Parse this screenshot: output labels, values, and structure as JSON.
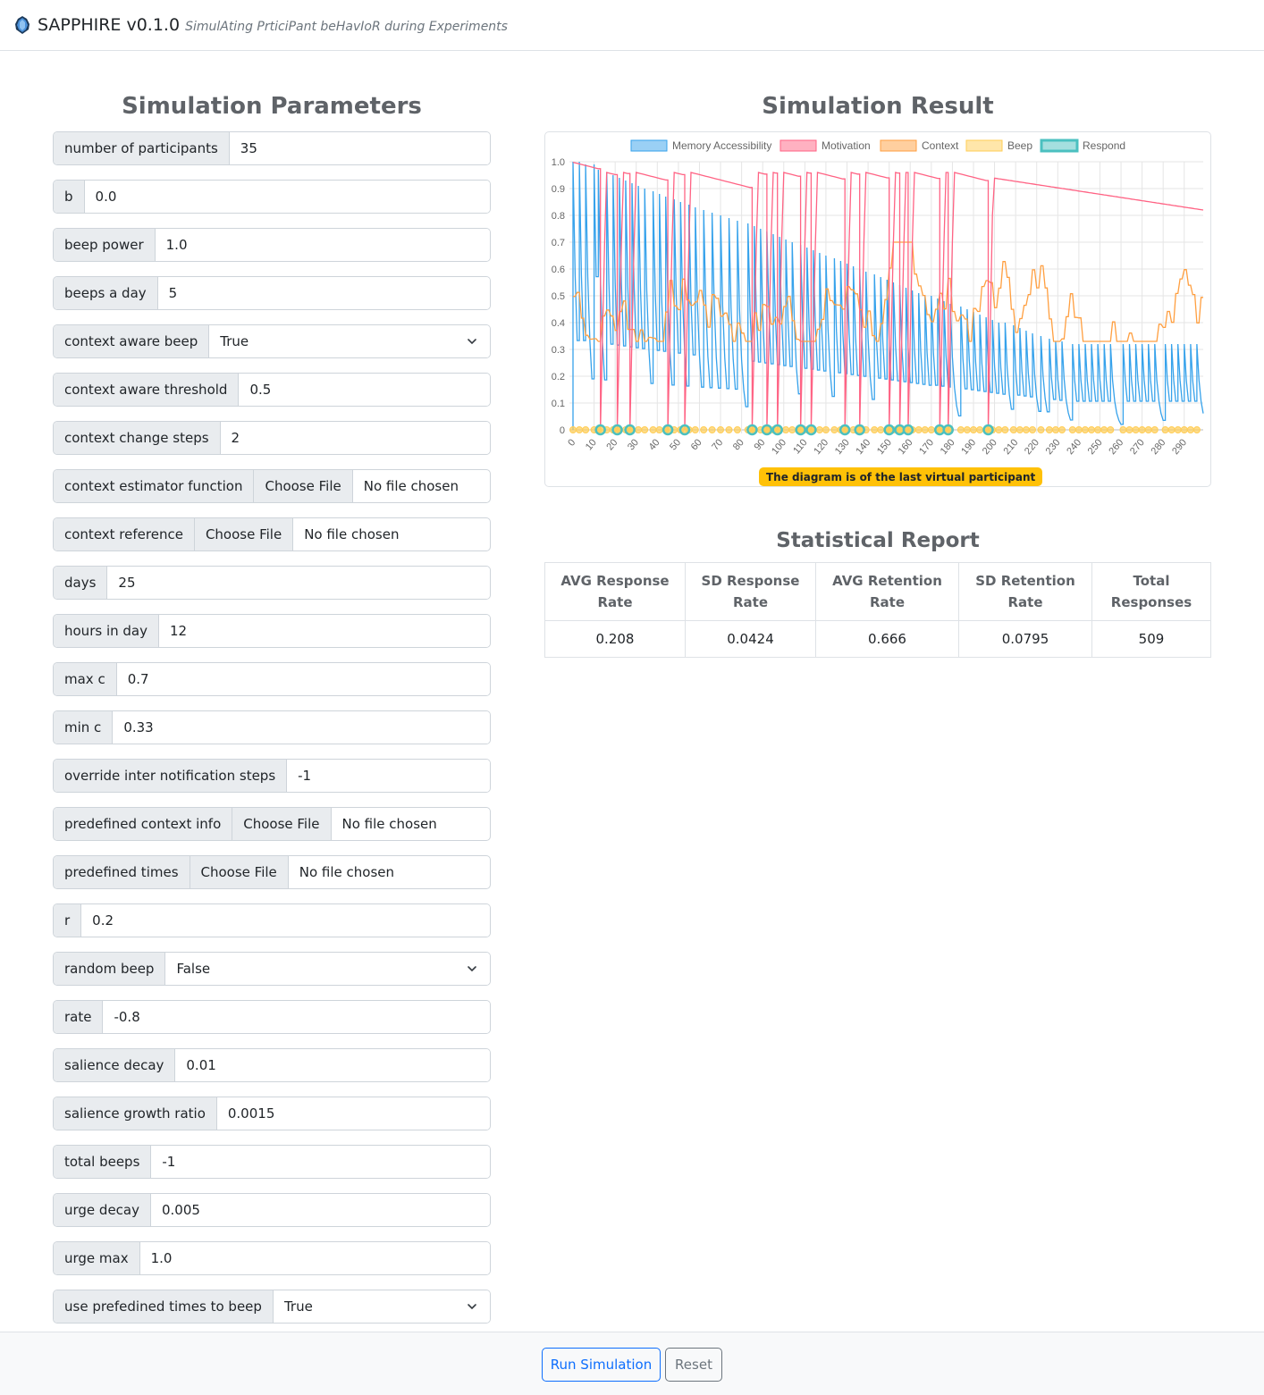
{
  "header": {
    "app_name": "SAPPHIRE v0.1.0",
    "tagline": "SimulAting PrticiPant beHavIoR during Experiments",
    "logo_icon": "sapphire-gem-icon"
  },
  "parameters": {
    "title": "Simulation Parameters",
    "fields": [
      {
        "label": "number of participants",
        "type": "input",
        "value": "35"
      },
      {
        "label": "b",
        "type": "input",
        "value": "0.0"
      },
      {
        "label": "beep power",
        "type": "input",
        "value": "1.0"
      },
      {
        "label": "beeps a day",
        "type": "input",
        "value": "5"
      },
      {
        "label": "context aware beep",
        "type": "select",
        "value": "True"
      },
      {
        "label": "context aware threshold",
        "type": "input",
        "value": "0.5"
      },
      {
        "label": "context change steps",
        "type": "input",
        "value": "2"
      },
      {
        "label": "context estimator function",
        "type": "file",
        "button": "Choose File",
        "value": "No file chosen"
      },
      {
        "label": "context reference",
        "type": "file",
        "button": "Choose File",
        "value": "No file chosen"
      },
      {
        "label": "days",
        "type": "input",
        "value": "25"
      },
      {
        "label": "hours in day",
        "type": "input",
        "value": "12"
      },
      {
        "label": "max c",
        "type": "input",
        "value": "0.7"
      },
      {
        "label": "min c",
        "type": "input",
        "value": "0.33"
      },
      {
        "label": "override inter notification steps",
        "type": "input",
        "value": "-1"
      },
      {
        "label": "predefined context info",
        "type": "file",
        "button": "Choose File",
        "value": "No file chosen"
      },
      {
        "label": "predefined times",
        "type": "file",
        "button": "Choose File",
        "value": "No file chosen"
      },
      {
        "label": "r",
        "type": "input",
        "value": "0.2"
      },
      {
        "label": "random beep",
        "type": "select",
        "value": "False"
      },
      {
        "label": "rate",
        "type": "input",
        "value": "-0.8"
      },
      {
        "label": "salience decay",
        "type": "input",
        "value": "0.01"
      },
      {
        "label": "salience growth ratio",
        "type": "input",
        "value": "0.0015"
      },
      {
        "label": "total beeps",
        "type": "input",
        "value": "-1"
      },
      {
        "label": "urge decay",
        "type": "input",
        "value": "0.005"
      },
      {
        "label": "urge max",
        "type": "input",
        "value": "1.0"
      },
      {
        "label": "use prefedined times to beep",
        "type": "select",
        "value": "True"
      }
    ]
  },
  "result": {
    "title": "Simulation Result",
    "note": "The diagram is of the last virtual participant"
  },
  "chart_data": {
    "type": "line",
    "title": "",
    "xlabel": "",
    "ylabel": "",
    "xlim": [
      0,
      299
    ],
    "ylim": [
      0,
      1.0
    ],
    "x_ticks": [
      0,
      10,
      20,
      30,
      40,
      50,
      60,
      70,
      80,
      90,
      100,
      110,
      120,
      130,
      140,
      150,
      160,
      170,
      180,
      190,
      200,
      210,
      220,
      230,
      240,
      250,
      260,
      270,
      280,
      290
    ],
    "y_ticks": [
      "0",
      "0.1",
      "0.2",
      "0.3",
      "0.4",
      "0.5",
      "0.6",
      "0.7",
      "0.8",
      "0.9",
      "1.0"
    ],
    "grid": true,
    "legend_position": "top",
    "series": [
      {
        "name": "Memory Accessibility",
        "color": "#36a2eb",
        "description": "sawtooth: jumps to peak at each beep then decays toward 0",
        "beep_steps": [
          0,
          3,
          6,
          10,
          12,
          16,
          19,
          22,
          25,
          28,
          31,
          34,
          38,
          41,
          44,
          48,
          51,
          55,
          58,
          62,
          66,
          70,
          74,
          78,
          83,
          86,
          89,
          92,
          95,
          98,
          101,
          104,
          108,
          111,
          114,
          117,
          120,
          124,
          127,
          130,
          133,
          136,
          139,
          143,
          146,
          149,
          152,
          155,
          158,
          161,
          164,
          167,
          170,
          173,
          176,
          179,
          184,
          187,
          190,
          193,
          196,
          199,
          202,
          205,
          209,
          212,
          215,
          218,
          222,
          226,
          229,
          232,
          237,
          240,
          243,
          246,
          249,
          252,
          255,
          261,
          264,
          267,
          270,
          273,
          276,
          281,
          284,
          287,
          290,
          293,
          296
        ],
        "peaks_approx": [
          1.0,
          1.0,
          0.99,
          0.99,
          0.97,
          0.96,
          0.95,
          0.94,
          0.93,
          0.92,
          0.91,
          0.9,
          0.89,
          0.88,
          0.87,
          0.86,
          0.85,
          0.84,
          0.83,
          0.82,
          0.81,
          0.8,
          0.79,
          0.78,
          0.77,
          0.76,
          0.75,
          0.74,
          0.73,
          0.72,
          0.71,
          0.7,
          0.69,
          0.68,
          0.67,
          0.66,
          0.65,
          0.64,
          0.63,
          0.62,
          0.61,
          0.6,
          0.59,
          0.58,
          0.57,
          0.56,
          0.55,
          0.54,
          0.53,
          0.52,
          0.51,
          0.5,
          0.5,
          0.49,
          0.48,
          0.47,
          0.46,
          0.45,
          0.44,
          0.43,
          0.42,
          0.41,
          0.4,
          0.4,
          0.39,
          0.38,
          0.37,
          0.36,
          0.35,
          0.34,
          0.33,
          0.33,
          0.32
        ]
      },
      {
        "name": "Motivation",
        "color": "#ff6384",
        "description": "drops to 0 on each response, recovers to ~0.95-0.99, then slowly decays from 0.94 to 0.82 after step 197",
        "response_steps": [
          13,
          21,
          27,
          45,
          53,
          85,
          92,
          97,
          108,
          113,
          129,
          136,
          150,
          155,
          159,
          174,
          178,
          197
        ],
        "plateau_approx": 0.96,
        "end_value": 0.82
      },
      {
        "name": "Context",
        "color": "#ff9f40",
        "description": "stepwise values between min c 0.33 and max c 0.7",
        "range": [
          0.33,
          0.7
        ]
      },
      {
        "name": "Beep",
        "color": "#ffcd56",
        "description": "points at y=0 at each beep step"
      },
      {
        "name": "Respond",
        "color": "#4bc0c0",
        "description": "points at y=0 at each response step",
        "steps": [
          13,
          21,
          27,
          45,
          53,
          85,
          92,
          97,
          108,
          113,
          129,
          136,
          150,
          155,
          159,
          174,
          178,
          197
        ]
      }
    ]
  },
  "report": {
    "title": "Statistical Report",
    "columns": [
      "AVG Response Rate",
      "SD Response Rate",
      "AVG Retention Rate",
      "SD Retention Rate",
      "Total Responses"
    ],
    "rows": [
      [
        "0.208",
        "0.0424",
        "0.666",
        "0.0795",
        "509"
      ]
    ]
  },
  "footer": {
    "run_label": "Run Simulation",
    "reset_label": "Reset"
  }
}
